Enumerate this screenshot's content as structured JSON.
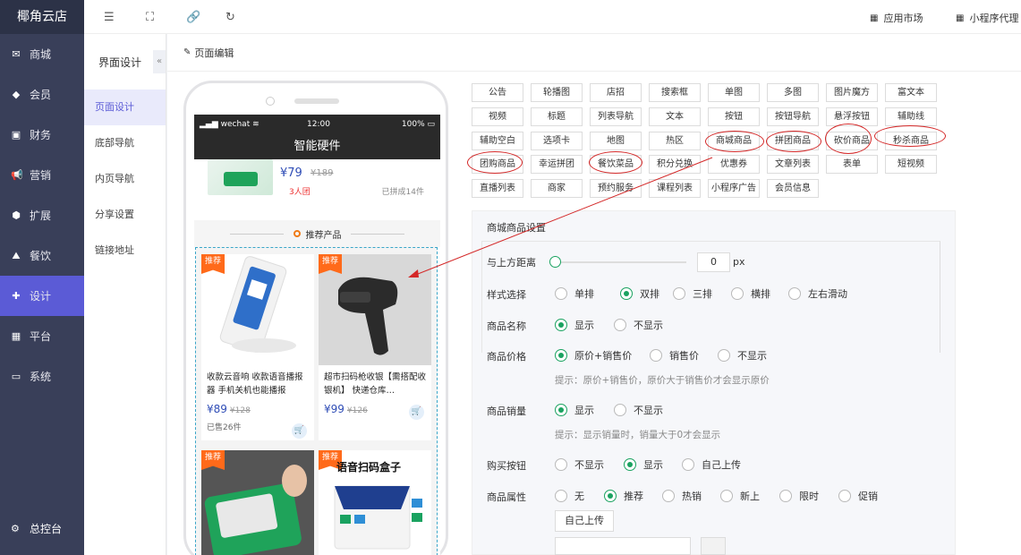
{
  "brand": "椰角云店",
  "sidebar": {
    "items": [
      {
        "label": "商城",
        "icon": "mail-icon"
      },
      {
        "label": "会员",
        "icon": "diamond-icon"
      },
      {
        "label": "财务",
        "icon": "wallet-icon"
      },
      {
        "label": "营销",
        "icon": "megaphone-icon"
      },
      {
        "label": "扩展",
        "icon": "cube-icon"
      },
      {
        "label": "餐饮",
        "icon": "dish-icon"
      },
      {
        "label": "设计",
        "icon": "puzzle-icon"
      },
      {
        "label": "平台",
        "icon": "grid-icon"
      },
      {
        "label": "系统",
        "icon": "monitor-icon"
      }
    ],
    "active": "设计",
    "bottom_label": "总控台"
  },
  "subnav": {
    "title": "界面设计",
    "items": [
      "页面设计",
      "底部导航",
      "内页导航",
      "分享设置",
      "链接地址"
    ],
    "active": "页面设计"
  },
  "topbar": {
    "app_market": "应用市场",
    "mini_agent": "小程序代理"
  },
  "page": {
    "title": "页面编辑"
  },
  "phone": {
    "carrier": "wechat",
    "time": "12:00",
    "battery": "100%",
    "title": "智能硬件",
    "group": {
      "price": "¥79",
      "old_price": "¥189",
      "tuan": "3人团",
      "done": "已拼成14件"
    },
    "recommend": "推荐产品",
    "products": [
      {
        "badge": "推荐",
        "name": "收款云音响 收款语音播报器 手机关机也能播报",
        "price": "¥89",
        "old_price": "¥128",
        "sold": "已售26件"
      },
      {
        "badge": "推荐",
        "name": "超市扫码枪收银【需搭配收银机】 快递仓库…",
        "price": "¥99",
        "old_price": "¥126",
        "sold": ""
      },
      {
        "badge": "推荐"
      },
      {
        "badge": "推荐",
        "overlay": "语音扫码盒子"
      }
    ]
  },
  "palette": [
    [
      "公告",
      "轮播图",
      "店招",
      "搜索框",
      "单图",
      "多图",
      "图片魔方",
      "富文本"
    ],
    [
      "视频",
      "标题",
      "列表导航",
      "文本",
      "按钮",
      "按钮导航",
      "悬浮按钮",
      "辅助线"
    ],
    [
      "辅助空白",
      "选项卡",
      "地图",
      "热区",
      "商城商品",
      "拼团商品",
      "砍价商品",
      "秒杀商品"
    ],
    [
      "团购商品",
      "幸运拼团",
      "餐饮菜品",
      "积分兑换",
      "优惠券",
      "文章列表",
      "表单",
      "短视频"
    ],
    [
      "直播列表",
      "商家",
      "预约服务",
      "课程列表",
      "小程序广告",
      "会员信息"
    ]
  ],
  "settings": {
    "title": "商城商品设置",
    "top_distance": {
      "label": "与上方距离",
      "value": "0",
      "unit": "px",
      "slider_fraction": 0
    },
    "style": {
      "label": "样式选择",
      "options": [
        "单排",
        "双排",
        "三排",
        "横排",
        "左右滑动"
      ],
      "selected": "双排"
    },
    "name": {
      "label": "商品名称",
      "options": [
        "显示",
        "不显示"
      ],
      "selected": "显示"
    },
    "price": {
      "label": "商品价格",
      "options": [
        "原价+销售价",
        "销售价",
        "不显示"
      ],
      "selected": "原价+销售价",
      "tip": "提示：原价+销售价，原价大于销售价才会显示原价"
    },
    "sales": {
      "label": "商品销量",
      "options": [
        "显示",
        "不显示"
      ],
      "selected": "显示",
      "tip": "提示：显示销量时，销量大于0才会显示"
    },
    "buy": {
      "label": "购买按钮",
      "options": [
        "不显示",
        "显示",
        "自己上传"
      ],
      "selected": "显示"
    },
    "attr": {
      "label": "商品属性",
      "options": [
        "无",
        "推荐",
        "热销",
        "新上",
        "限时",
        "促销"
      ],
      "selected": "推荐"
    },
    "upload_label": "自己上传"
  },
  "colors": {
    "accent": "#5b5bd6",
    "sidebar": "#393f59",
    "price": "#2f4db6",
    "green": "#1aa260",
    "annotation": "#d42828"
  }
}
